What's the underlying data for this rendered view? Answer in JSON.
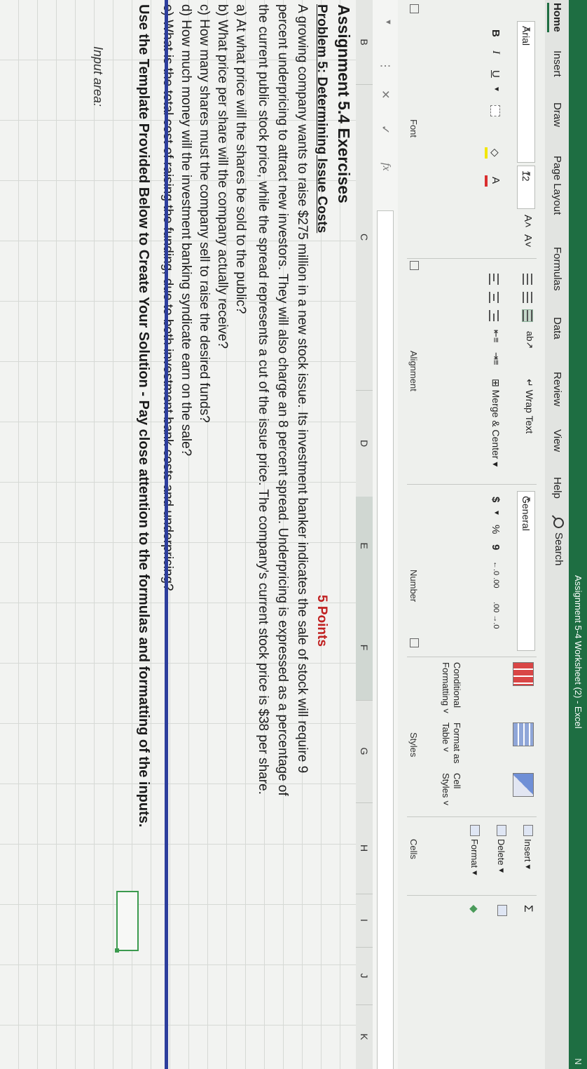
{
  "window": {
    "title": "Assignment 5-4 Worksheet (2)  -  Excel",
    "corner": "N"
  },
  "ribbon_tabs": [
    "Home",
    "Insert",
    "Draw",
    "Page Layout",
    "Formulas",
    "Data",
    "Review",
    "View",
    "Help"
  ],
  "search": {
    "label": "Search"
  },
  "font_group": {
    "font_name": "Arial",
    "font_size": "12",
    "grow": "A˄",
    "shrink": "A˅",
    "bold": "B",
    "italic": "I",
    "underline": "U",
    "font_color": "A",
    "label": "Font"
  },
  "alignment_group": {
    "wrap_text": "Wrap Text",
    "merge_center": "Merge & Center",
    "label": "Alignment"
  },
  "number_group": {
    "format": "General",
    "currency": "$",
    "percent": "%",
    "comma": "9",
    "increase_decimal": "←.0 .00",
    "decrease_decimal": ".00 →.0",
    "label": "Number"
  },
  "styles_group": {
    "conditional": "Conditional Formatting ˅",
    "format_table": "Format as Table ˅",
    "cell_styles": "Cell Styles ˅",
    "label": "Styles"
  },
  "cells_group": {
    "insert": "Insert",
    "delete": "Delete",
    "format": "Format",
    "label": "Cells"
  },
  "formula_bar": {
    "cancel": "✕",
    "enter": "✓",
    "fx": "fx",
    "dots": "⋮"
  },
  "columns": [
    "B",
    "C",
    "D",
    "E",
    "F",
    "G",
    "H",
    "I",
    "J",
    "K"
  ],
  "content": {
    "heading": "Assignment 5.4 Exercises",
    "problem_title": "Problem 5: Determining Issue Costs",
    "points": "5 Points",
    "para_line1": "A growing company wants to raise $275 million in a new stock issue.  Its investment banker indicates the sale of stock will require 9",
    "para_line2": "percent underpricing to attract new investors.  They will also charge an 8 percent spread.  Underpricing is expressed as a percentage of",
    "para_line3": "the current public stock price, while the spread represents a cut of the issue price.  The company's current stock price is $38 per share.",
    "q_a": "a) At what price will the shares be sold to the public?",
    "q_b": "b) What price per share will the company actually receive?",
    "q_c": "c) How many shares must the company sell to raise the desired funds?",
    "q_d": "d) How much money will the investment banking syndicate earn on the sale?",
    "q_e": "e) What is the total cost of raising the funding, due to both investment bank costs and underpricing?",
    "instruction": "Use the Template Provided Below to Create Your Solution - Pay close attention to the formulas and formatting of the inputs.",
    "input_label": "Input area:"
  },
  "colors": {
    "excel_green": "#1e6e42",
    "points_red": "#c02020",
    "divider_blue": "#2d3e9c",
    "input_border": "#3b9a4e"
  }
}
